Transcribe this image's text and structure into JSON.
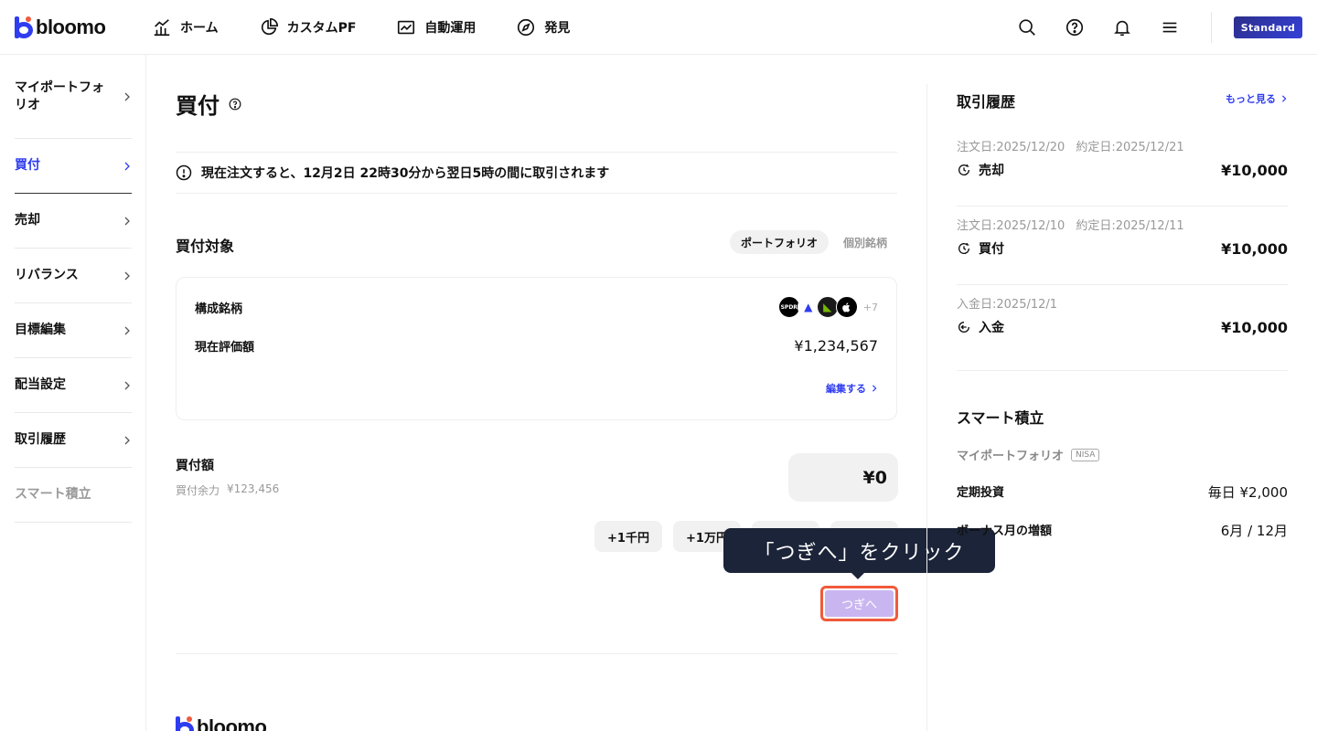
{
  "header": {
    "logo": "bloomo",
    "nav": [
      "ホーム",
      "カスタムPF",
      "自動運用",
      "発見"
    ],
    "plan_badge": "Standard"
  },
  "sidebar": {
    "items": [
      {
        "label": "マイポートフォリオ"
      },
      {
        "label": "買付"
      },
      {
        "label": "売却"
      },
      {
        "label": "リバランス"
      },
      {
        "label": "目標編集"
      },
      {
        "label": "配当設定"
      },
      {
        "label": "取引履歴"
      },
      {
        "label": "スマート積立"
      }
    ]
  },
  "main": {
    "title": "買付",
    "notice": "現在注文すると、12月2日 22時30分から翌日5時の間に取引されます",
    "target_title": "買付対象",
    "segments": [
      "ポートフォリオ",
      "個別銘柄"
    ],
    "holdings_label": "構成銘柄",
    "holdings_more": "+7",
    "holding_chips": [
      "SPDR",
      "▲",
      "◣",
      ""
    ],
    "valuation_label": "現在評価額",
    "valuation_value": "¥1,234,567",
    "edit_link": "編集する",
    "amount_label": "買付額",
    "available_label": "買付余力",
    "available_value": "¥123,456",
    "amount_value": "¥0",
    "quick_buttons": [
      "+1千円",
      "+1万円"
    ],
    "next_button": "つぎへ",
    "tooltip": "「つぎへ」をクリック",
    "footer_logo": "bloomo"
  },
  "right": {
    "history_title": "取引履歴",
    "more_link": "もっと見る",
    "transactions": [
      {
        "dates": [
          "注文日:2025/12/20",
          "約定日:2025/12/21"
        ],
        "type": "売却",
        "amount": "¥10,000"
      },
      {
        "dates": [
          "注文日:2025/12/10",
          "約定日:2025/12/11"
        ],
        "type": "買付",
        "amount": "¥10,000"
      },
      {
        "dates": [
          "入金日:2025/12/1"
        ],
        "type": "入金",
        "amount": "¥10,000"
      }
    ],
    "smart_title": "スマート積立",
    "smart_pf": "マイポートフォリオ",
    "smart_badge": "NISA",
    "rows": [
      {
        "label": "定期投資",
        "value": "毎日 ¥2,000"
      },
      {
        "label": "ボーナス月の増額",
        "value": "6月 / 12月"
      }
    ]
  }
}
